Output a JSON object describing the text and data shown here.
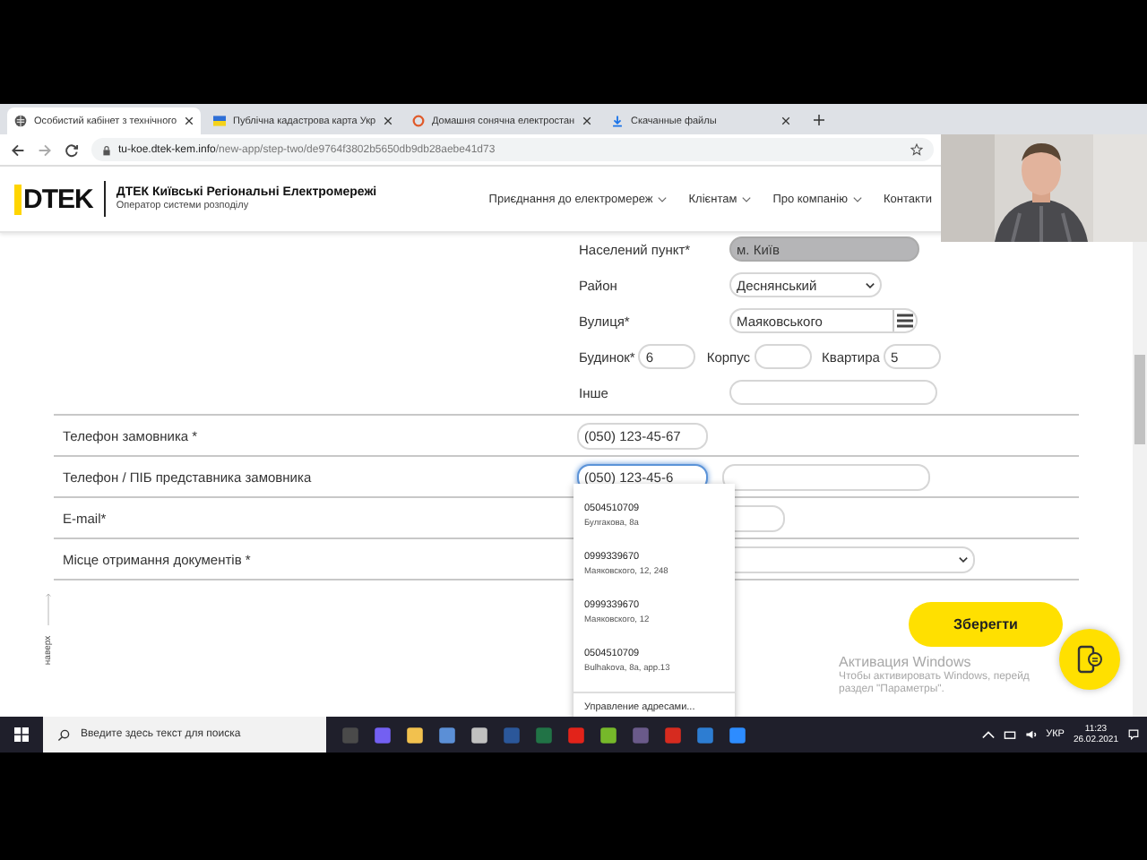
{
  "browser": {
    "tabs": [
      {
        "title": "Особистий кабінет з технічного",
        "selected": true
      },
      {
        "title": "Публічна кадастрова карта Укр",
        "selected": false
      },
      {
        "title": "Домашня сонячна електростан",
        "selected": false
      },
      {
        "title": "Скачанные файлы",
        "selected": false
      }
    ],
    "url_host": "tu-koe.dtek-kem.info",
    "url_path": "/new-app/step-two/de9764f3802b5650db9db28aebe41d73"
  },
  "header": {
    "logo": "DTEK",
    "title": "ДТЕК Київські Регіональні Електромережі",
    "subtitle": "Оператор системи розподілу",
    "nav": [
      {
        "label": "Приєднання до електромереж",
        "dropdown": true
      },
      {
        "label": "Клієнтам",
        "dropdown": true
      },
      {
        "label": "Про компанію",
        "dropdown": true
      },
      {
        "label": "Контакти",
        "dropdown": false
      }
    ]
  },
  "address": [
    {
      "label": "Населений пункт*",
      "value": "м. Київ",
      "kind": "locked"
    },
    {
      "label": "Район",
      "value": "Деснянський",
      "kind": "select"
    },
    {
      "label": "Вулиця*",
      "value": "Маяковського",
      "kind": "list"
    }
  ],
  "building": [
    {
      "label": "Будинок*",
      "value": "6"
    },
    {
      "label": "Корпус"
    },
    {
      "label": "Квартира",
      "value": "5"
    }
  ],
  "other": {
    "label": "Інше"
  },
  "contacts": [
    {
      "label": "Телефон замовника *",
      "value": "(050) 123-45-67",
      "kind": "phone",
      "focused": false
    },
    {
      "label": "Телефон / ПІБ представника замовника",
      "value": "(050) 123-45-6",
      "kind": "phone_name",
      "focused": true
    },
    {
      "label": "E-mail*",
      "kind": "email"
    },
    {
      "label": "Місце отримання документів *",
      "kind": "select"
    }
  ],
  "autocomplete": {
    "items": [
      {
        "number": "0504510709",
        "address": "Булгакова, 8а"
      },
      {
        "number": "0999339670",
        "address": "Маяковского, 12, 248"
      },
      {
        "number": "0999339670",
        "address": "Маяковского, 12"
      },
      {
        "number": "0504510709",
        "address": "Bulhakova, 8a, app.13"
      }
    ],
    "footer": "Управление адресами..."
  },
  "save_button": "Зберегти",
  "back_to_top": "наверх",
  "activation": {
    "title": "Активация Windows",
    "line_1": "Чтобы активировать Windows, перейд",
    "line_2": "раздел \"Параметры\"."
  },
  "taskbar": {
    "search_placeholder": "Введите здесь текст для поиска",
    "language": "УКР",
    "time": "11:23",
    "date": "26.02.2021"
  }
}
